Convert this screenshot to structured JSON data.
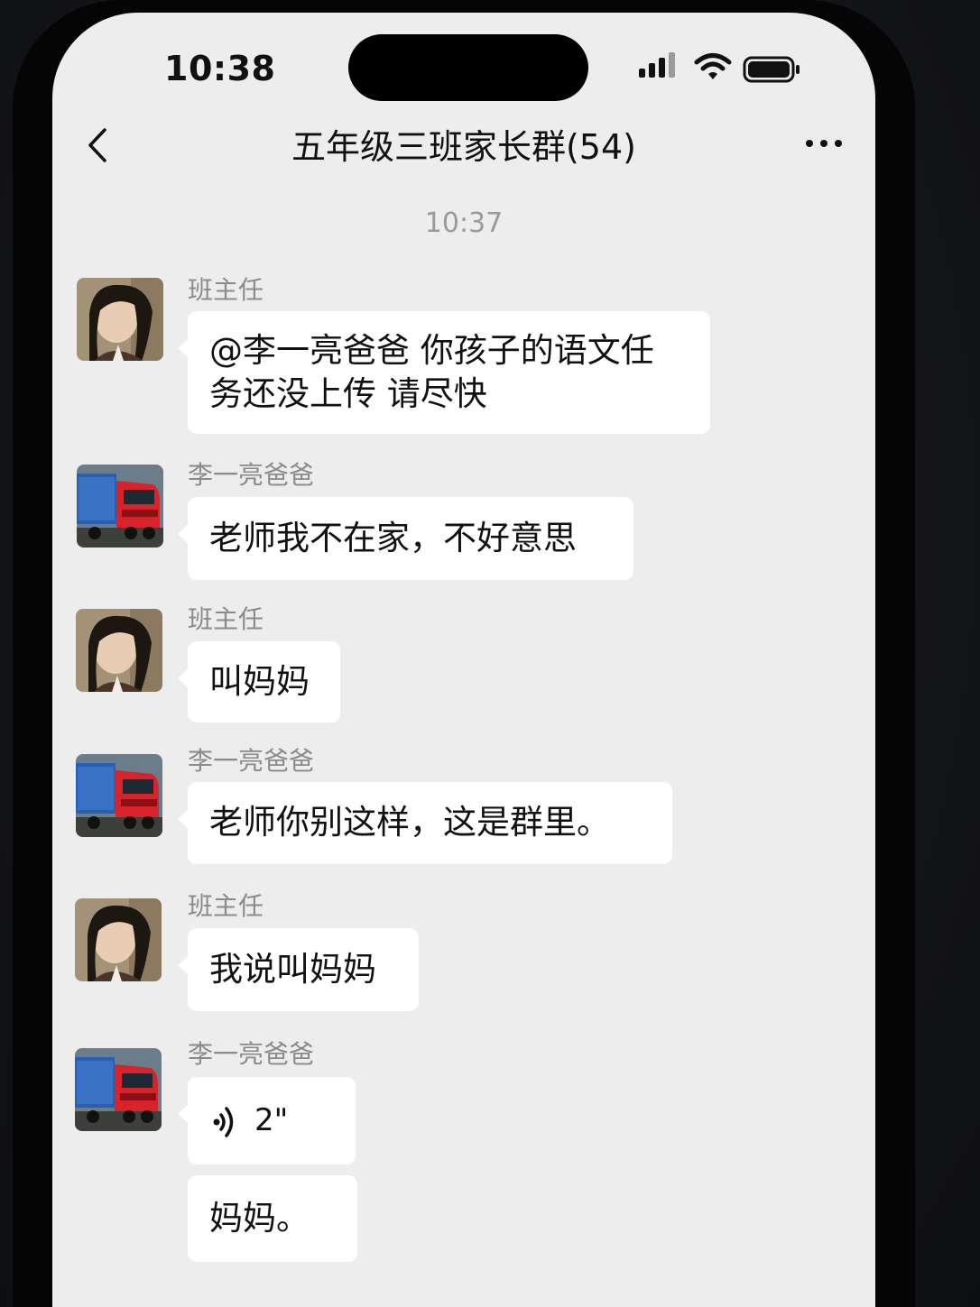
{
  "status_bar": {
    "time": "10:38"
  },
  "nav": {
    "title": "五年级三班家长群(54)"
  },
  "time_separator": "10:37",
  "messages": [
    {
      "sender": "班主任",
      "text": "@李一亮爸爸 你孩子的语文任务还没上传 请尽快",
      "line1": "@李一亮爸爸 你孩子的语文任",
      "line2": "务还没上传 请尽快"
    },
    {
      "sender": "李一亮爸爸",
      "text": "老师我不在家，不好意思"
    },
    {
      "sender": "班主任",
      "text": "叫妈妈"
    },
    {
      "sender": "李一亮爸爸",
      "text": "老师你别这样，这是群里。"
    },
    {
      "sender": "班主任",
      "text": "我说叫妈妈"
    },
    {
      "sender": "李一亮爸爸",
      "voice_duration": "2\"",
      "text": "妈妈。"
    }
  ],
  "colors": {
    "screen_bg": "#ededed",
    "bubble_bg": "#ffffff",
    "text": "#111111",
    "muted": "#8a8a8a"
  },
  "icons": [
    "back-chevron-icon",
    "more-dots-icon",
    "signal-icon",
    "wifi-icon",
    "battery-icon",
    "voice-wave-icon"
  ]
}
